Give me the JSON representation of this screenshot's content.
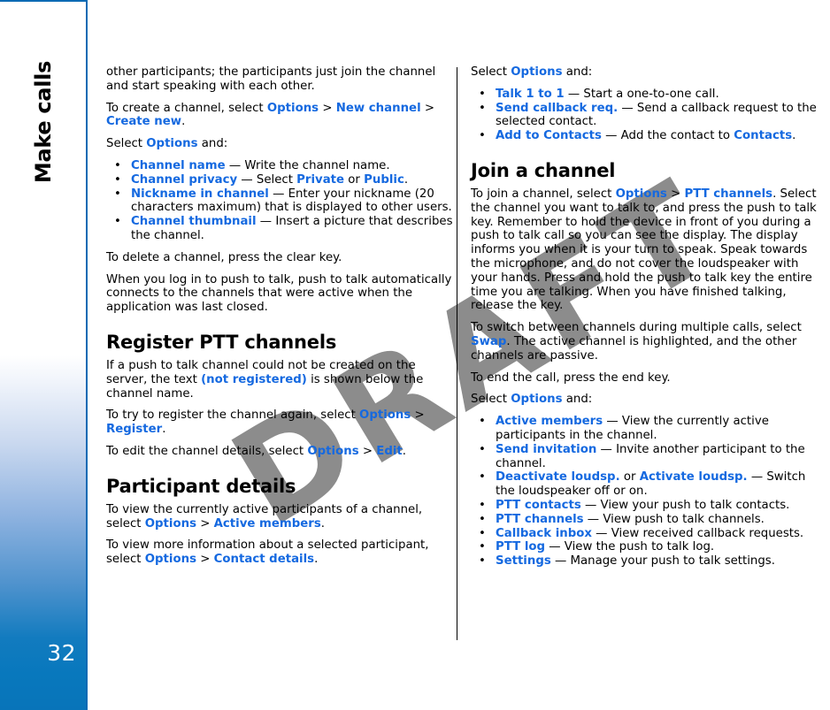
{
  "page": {
    "number": "32",
    "chapter_title": "Make calls",
    "watermark": "DRAFT",
    "accent_color": "#1569e0",
    "sidebar_color": "#0874b9"
  },
  "left_column": {
    "para_continued": "other participants; the participants just join the channel and start speaking with each other.",
    "para_create_channel": {
      "lead": "To create a channel, select ",
      "link1": "Options",
      "sep1": ">",
      "link2": "New channel",
      "sep2": ">",
      "link3": "Create new",
      "tail": "."
    },
    "select_options_and": {
      "lead": "Select ",
      "link": "Options",
      "tail": " and:"
    },
    "channel_options": [
      {
        "bullet": "•",
        "term": "Channel name",
        "desc": " — Write the channel name."
      },
      {
        "bullet": "•",
        "term": "Channel privacy",
        "desc_pre": " — Select ",
        "opt1": "Private",
        "mid": " or ",
        "opt2": "Public",
        "desc_post": "."
      },
      {
        "bullet": "•",
        "term": "Nickname in channel",
        "desc": " — Enter your nickname (20 characters maximum) that is displayed to other users."
      },
      {
        "bullet": "•",
        "term": "Channel thumbnail",
        "desc": " — Insert a picture that describes the channel."
      }
    ],
    "para_delete": "To delete a channel, press the clear key.",
    "para_login": "When you log in to push to talk, push to talk automatically connects to the channels that were active when the application was last closed.",
    "heading_register": "Register PTT channels",
    "para_register_1": {
      "lead": "If a push to talk channel could not be created on the server, the text ",
      "link": "(not registered)",
      "tail": " is shown below the channel name."
    },
    "para_register_2": {
      "lead": "To try to register the channel again, select ",
      "link1": "Options",
      "sep1": ">",
      "link2": "Register",
      "tail": "."
    },
    "para_register_3": {
      "lead": "To edit the channel details, select ",
      "link1": "Options",
      "sep1": ">",
      "link2": "Edit",
      "tail": "."
    },
    "heading_participant": "Participant details",
    "para_participant_1": {
      "lead": "To view the currently active participants of a channel, select ",
      "link1": "Options",
      "sep1": ">",
      "link2": "Active members",
      "tail": "."
    },
    "para_participant_2": {
      "lead": "To view more information about a selected participant, select ",
      "link1": "Options",
      "sep1": ">",
      "link2": "Contact details",
      "tail": "."
    }
  },
  "right_column": {
    "select_options_and": {
      "lead": "Select ",
      "link": "Options",
      "tail": " and:"
    },
    "contact_options": [
      {
        "bullet": "•",
        "term": "Talk 1 to 1",
        "desc": " — Start a one-to-one call."
      },
      {
        "bullet": "•",
        "term": "Send callback req.",
        "desc": " — Send a callback request to the selected contact."
      },
      {
        "bullet": "•",
        "term": "Add to Contacts",
        "desc_pre": " — Add the contact to ",
        "opt1": "Contacts",
        "desc_post": "."
      }
    ],
    "heading_join": "Join a channel",
    "para_join": {
      "lead": "To join a channel, select ",
      "link1": "Options",
      "sep1": ">",
      "link2": "PTT channels",
      "tail": ". Select the channel you want to talk to, and press the push to talk key. Remember to hold the device in front of you during a push to talk call so you can see the display. The display informs you when it is your turn to speak. Speak towards the microphone, and do not cover the loudspeaker with your hands. Press and hold the push to talk key the entire time you are talking. When you have finished talking, release the key."
    },
    "para_switch": {
      "lead": "To switch between channels during multiple calls, select ",
      "link": "Swap",
      "tail": ". The active channel is highlighted, and the other channels are passive."
    },
    "para_end_call": "To end the call, press the end key.",
    "select_options_and_2": {
      "lead": "Select ",
      "link": "Options",
      "tail": " and:"
    },
    "channel_call_options": [
      {
        "bullet": "•",
        "term": "Active members",
        "desc": " — View the currently active participants in the channel."
      },
      {
        "bullet": "•",
        "term": "Send invitation",
        "desc": " — Invite another participant to the channel."
      },
      {
        "bullet": "•",
        "term": "Deactivate loudsp.",
        "mid": " or ",
        "term2": "Activate loudsp.",
        "desc": " — Switch the loudspeaker off or on."
      },
      {
        "bullet": "•",
        "term": "PTT contacts",
        "desc": " — View your push to talk contacts."
      },
      {
        "bullet": "•",
        "term": "PTT channels",
        "desc": " — View push to talk channels."
      },
      {
        "bullet": "•",
        "term": "Callback inbox",
        "desc": " — View received callback requests."
      },
      {
        "bullet": "•",
        "term": "PTT log",
        "desc": " — View the push to talk log."
      },
      {
        "bullet": "•",
        "term": "Settings",
        "desc": " — Manage your push to talk settings."
      }
    ]
  }
}
